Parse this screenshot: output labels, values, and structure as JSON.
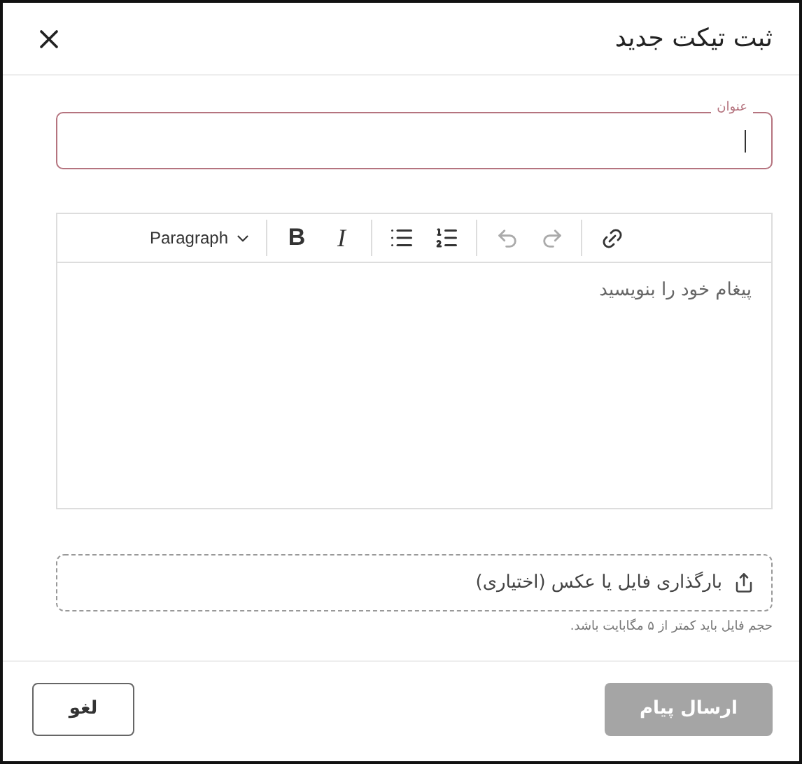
{
  "dialog": {
    "title": "ثبت تیکت جدید"
  },
  "title_field": {
    "label": "عنوان",
    "focused": true
  },
  "editor": {
    "toolbar": [
      {
        "kind": "link",
        "disabled": false
      },
      {
        "kind": "separator"
      },
      {
        "kind": "redo",
        "disabled": true
      },
      {
        "kind": "undo",
        "disabled": true
      },
      {
        "kind": "separator"
      },
      {
        "kind": "numbered-list",
        "disabled": false
      },
      {
        "kind": "bullet-list",
        "disabled": false
      },
      {
        "kind": "separator"
      },
      {
        "kind": "italic",
        "label": "I",
        "disabled": false
      },
      {
        "kind": "bold",
        "label": "B",
        "disabled": false
      },
      {
        "kind": "separator"
      },
      {
        "kind": "dropdown",
        "label": "Paragraph",
        "disabled": false
      }
    ],
    "placeholder": "پیغام خود را بنویسید"
  },
  "upload": {
    "label": "بارگذاری فایل یا عکس (اختیاری)",
    "hint": "حجم فایل باید کمتر از ۵ مگابایت باشد."
  },
  "buttons": [
    {
      "kind": "primary",
      "label": "ارسال پیام",
      "disabled": true
    },
    {
      "kind": "secondary",
      "label": "لغو",
      "disabled": false
    }
  ]
}
